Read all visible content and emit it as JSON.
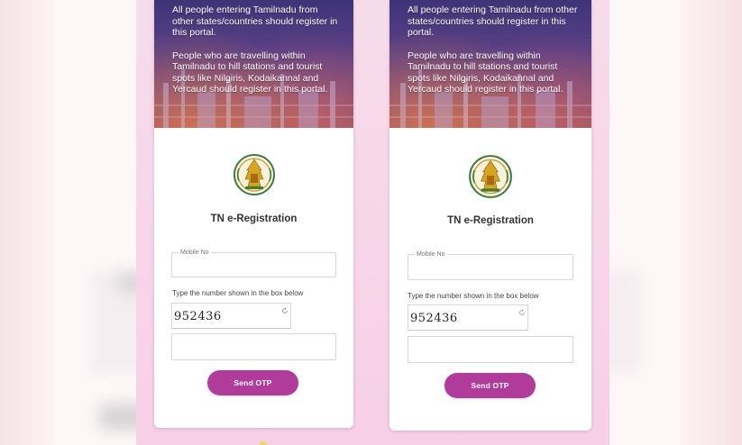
{
  "banner": {
    "para1": "All people entering Tamilnadu from other states/countries should register in this portal.",
    "para2": "People who are travelling within Tamilnadu to hill stations and tourist spots like Nilgiris, Kodaikannal and Yercaud should register in this portal."
  },
  "form": {
    "title": "TN e-Registration",
    "mobile_label": "Mobile No",
    "captcha_prompt": "Type the number shown in the box below",
    "captcha_code": "952436",
    "send_otp_label": "Send OTP"
  },
  "colors": {
    "accent": "#b03b9b",
    "banner_top": "#3e3477",
    "collage_bg": "#f6dcea"
  },
  "icons": [
    "tn-emblem-icon",
    "refresh-icon"
  ]
}
